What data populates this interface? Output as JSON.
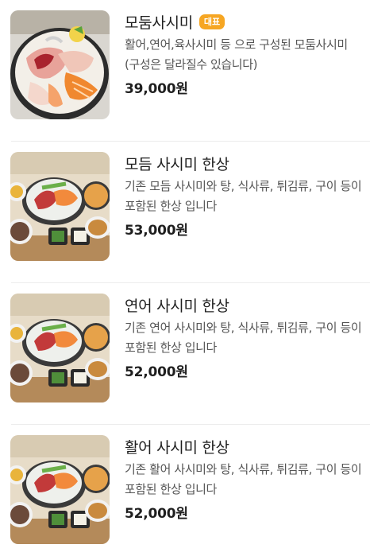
{
  "menu": {
    "items": [
      {
        "name": "모둠사시미",
        "badge": "대표",
        "description": "활어,연어,육사시미 등 으로 구성된 모둠사시미(구성은 달라질수 있습니다)",
        "price": "39,000원",
        "image": "platter-photo"
      },
      {
        "name": "모듬 사시미 한상",
        "badge": "",
        "description": "기존 모듬 사시미와 탕, 식사류, 튀김류, 구이 등이 포함된 한상 입니다",
        "price": "53,000원",
        "image": "table-set-photo"
      },
      {
        "name": "연어 사시미 한상",
        "badge": "",
        "description": "기존 연어 사시미와 탕, 식사류, 튀김류, 구이 등이 포함된 한상 입니다",
        "price": "52,000원",
        "image": "table-set-photo"
      },
      {
        "name": "활어 사시미 한상",
        "badge": "",
        "description": "기존 활어 사시미와 탕, 식사류, 튀김류, 구이 등이 포함된 한상 입니다",
        "price": "52,000원",
        "image": "table-set-photo"
      }
    ]
  },
  "colors": {
    "badge": "#f6a623",
    "divider": "#ececec"
  }
}
